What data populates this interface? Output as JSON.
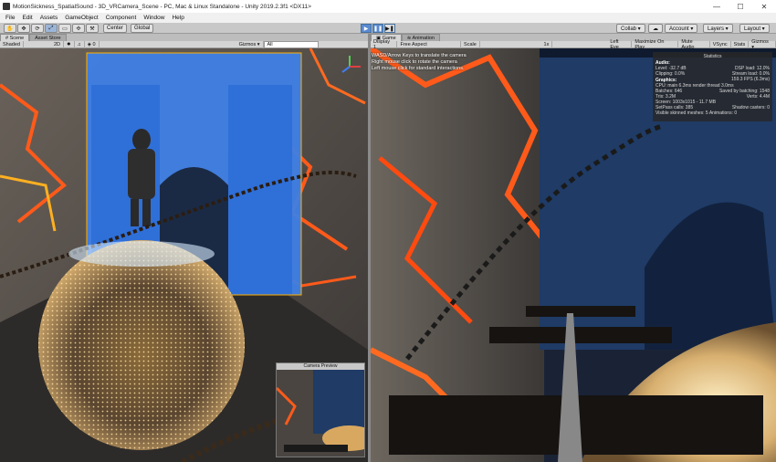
{
  "window": {
    "title": "MotionSickness_SpatialSound - 3D_VRCamera_Scene - PC, Mac & Linux Standalone - Unity 2019.2.3f1 <DX11>",
    "controls": [
      "—",
      "☐",
      "✕"
    ]
  },
  "menu": [
    "File",
    "Edit",
    "Assets",
    "GameObject",
    "Component",
    "Window",
    "Help"
  ],
  "toolbar": {
    "tools": [
      "✋",
      "✥",
      "⟳",
      "⤢",
      "▭",
      "✣",
      "⚒"
    ],
    "pivot_center": "Center",
    "pivot_global": "Global",
    "play_buttons": [
      "▶",
      "❚❚",
      "▶❚"
    ],
    "collab": "Collab ▾",
    "cloud_icon": "☁",
    "account": "Account ▾",
    "layers": "Layers ▾",
    "layout": "Layout ▾"
  },
  "scene_panel": {
    "tabs": [
      "# Scene",
      "Asset Store"
    ],
    "draw_mode": "Shaded",
    "mode_2d": "2D",
    "toggles": [
      "✹",
      "♫",
      "◈ 0"
    ],
    "gizmos": "Gizmos ▾",
    "search_placeholder": "All"
  },
  "game_panel": {
    "tabs": [
      "▣ Game",
      "≋ Animation"
    ],
    "display": "Display 1",
    "aspect": "Free Aspect",
    "scale_label": "Scale",
    "scale_value": "1x",
    "eye": "Left Eye",
    "options": [
      "Maximize On Play",
      "Mute Audio",
      "VSync",
      "Stats",
      "Gizmos ▾"
    ]
  },
  "help_text": [
    "WASD/Arrow Keys to translate the camera",
    "Right mouse click to rotate the camera",
    "Left mouse click for standard interactions."
  ],
  "stats": {
    "title": "Statistics",
    "audio_label": "Audio:",
    "audio_rows": [
      [
        "Level: -32.7 dB",
        "DSP load: 12.0%"
      ],
      [
        "Clipping: 0.0%",
        "Stream load: 0.0%"
      ]
    ],
    "graphics_label": "Graphics:",
    "fps": "159.3 FPS (6.3ms)",
    "graphics_rows": [
      [
        "CPU: main 6.3ms  render thread 3.0ms"
      ],
      [
        "Batches: 646",
        "Saved by batching: 1548"
      ],
      [
        "Tris: 3.2M",
        "Verts: 4.4M"
      ],
      [
        "Screen: 1003x1015 - 11.7 MB"
      ],
      [
        "SetPass calls: 385",
        "Shadow casters: 0"
      ],
      [
        "Visible skinned meshes: 5  Animations: 0"
      ]
    ]
  },
  "camera_preview": {
    "title": "Camera Preview"
  },
  "colors": {
    "selection_blue": "#3f7fe5",
    "lava": "#ff5a1a",
    "wall_navy": "#1f3b66",
    "rock": "#6f6b66"
  }
}
